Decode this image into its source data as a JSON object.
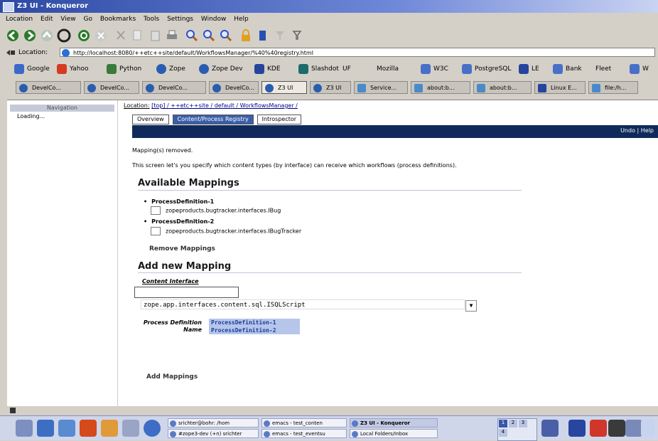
{
  "window": {
    "title": "Z3 UI - Konqueror"
  },
  "menu": [
    "Location",
    "Edit",
    "View",
    "Go",
    "Bookmarks",
    "Tools",
    "Settings",
    "Window",
    "Help"
  ],
  "toolbar_icons": [
    "back-icon",
    "forward-icon",
    "up-icon",
    "home-icon",
    "reload-icon",
    "stop-icon",
    "cut-icon",
    "copy-icon",
    "paste-icon",
    "print-icon",
    "find-icon",
    "zoom-in-icon",
    "zoom-out-icon",
    "lock-icon",
    "bookmark-icon",
    "filter-icon"
  ],
  "location": {
    "label": "Location:",
    "url": "http://localhost:8080/++etc++site/default/WorkflowsManager/%40%40registry.html"
  },
  "bookmarks": [
    "Google",
    "Yahoo",
    "Python",
    "Zope",
    "Zope Dev",
    "KDE",
    "Slashdot",
    "UF",
    "Mozilla",
    "W3C",
    "PostgreSQL",
    "LE",
    "Bank",
    "Fleet",
    "W"
  ],
  "tabs": [
    "DevelCo...",
    "DevelCo...",
    "DevelCo...",
    "DevelCo...",
    "Z3 UI",
    "Z3 UI",
    "Service...",
    "about:b...",
    "about:b...",
    "Linux E...",
    "file:/h..."
  ],
  "active_tab": 4,
  "sidebar": {
    "title": "Navigation",
    "status": "Loading..."
  },
  "breadcrumb": {
    "label": "Location:",
    "path": "[top] / ++etc++site / default / WorkflowsManager /"
  },
  "zmi_tabs": [
    "Overview",
    "Content/Process Registry",
    "Introspector"
  ],
  "header_links": "Undo | Help",
  "message": "Mapping(s) removed.",
  "description": "This screen let's you specify which content types (by interface) can receive which workflows (process definitions).",
  "available": {
    "heading": "Available Mappings",
    "items": [
      {
        "name": "ProcessDefinition-1",
        "interface": "zopeproducts.bugtracker.interfaces.IBug"
      },
      {
        "name": "ProcessDefinition-2",
        "interface": "zopeproducts.bugtracker.interfaces.IBugTracker"
      }
    ],
    "remove_button": "Remove Mappings"
  },
  "add": {
    "heading": "Add new Mapping",
    "content_interface_label": "Content Interface",
    "interface_input": "",
    "interface_select": "zope.app.interfaces.content.sql.ISQLScript",
    "process_label": "Process Definition Name",
    "process_options": [
      "ProcessDefinition-1",
      "ProcessDefinition-2"
    ],
    "add_button": "Add Mappings"
  },
  "taskbar": {
    "tasks": [
      "srichter@bohr: /hom",
      "#zope3-dev (+n) srichter",
      "emacs - test_conten",
      "emacs - test_eventsu",
      "Z3 UI - Konqueror",
      "Local Folders/Inbox"
    ],
    "pager": [
      "1",
      "2",
      "3",
      "4"
    ]
  }
}
